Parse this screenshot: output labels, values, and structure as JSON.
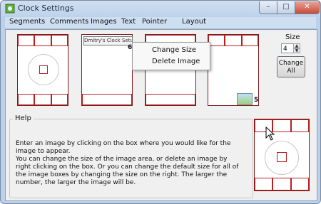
{
  "window": {
    "title": "Clock Settings"
  },
  "titlebar": {
    "minimize": "–",
    "maximize": "□",
    "close": "✕"
  },
  "menu": [
    "Segments",
    "Comments",
    "Images",
    "Text",
    "Pointer",
    "Layout"
  ],
  "cards": [
    {
      "badge": ""
    },
    {
      "image_label": "Dmitry's Clock Setup",
      "badge": "6"
    },
    {
      "badge": ""
    },
    {
      "badge": "5"
    }
  ],
  "context_menu": {
    "items": [
      "Change Size",
      "Delete Image"
    ]
  },
  "size": {
    "label": "Size",
    "value": "4"
  },
  "change_all": {
    "label_line1": "Change",
    "label_line2": "All"
  },
  "help": {
    "title": "Help",
    "p1": "Enter an image by clicking on the box where you would like for the image to appear.",
    "p2": "You can change the size of the image area, or delete an image by right clicking on the box. Or you can change the default size for all of the image boxes by changing the size on the right. The larger the number, the larger the image will be."
  },
  "colors": {
    "accent": "#b82020",
    "frame": "#bcd2ea"
  }
}
